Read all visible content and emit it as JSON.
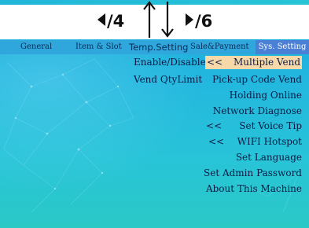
{
  "nav_hints": {
    "prev_page": "/4",
    "next_page": "/6"
  },
  "tabs": [
    {
      "label": "General"
    },
    {
      "label": "Item & Slot"
    },
    {
      "label": "Temp.Setting"
    },
    {
      "label": "Sale&Payment"
    },
    {
      "label": "Sys. Setting",
      "selected": true
    }
  ],
  "left_column": [
    {
      "label": "Enable/Disable"
    },
    {
      "label": "Vend QtyLimit"
    }
  ],
  "right_menu": [
    {
      "mark": "<<",
      "label": "Multiple Vend",
      "highlighted": true
    },
    {
      "label": "Pick-up Code Vend"
    },
    {
      "label": "Holding Online"
    },
    {
      "label": "Network Diagnose"
    },
    {
      "mark": "<<",
      "label": "Set Voice Tip"
    },
    {
      "mark": "<<",
      "label": "WIFI Hotspot"
    },
    {
      "label": "Set Language"
    },
    {
      "label": "Set Admin Password"
    },
    {
      "label": "About This Machine"
    }
  ],
  "colors": {
    "background_top": "#1aa7d8",
    "background_bottom": "#2ac9c6",
    "tab_bar": "#2fa7dc",
    "selected_tab": "#4a7fd6",
    "highlight_item": "#f7d9a9",
    "menu_text": "#0d1a44"
  }
}
